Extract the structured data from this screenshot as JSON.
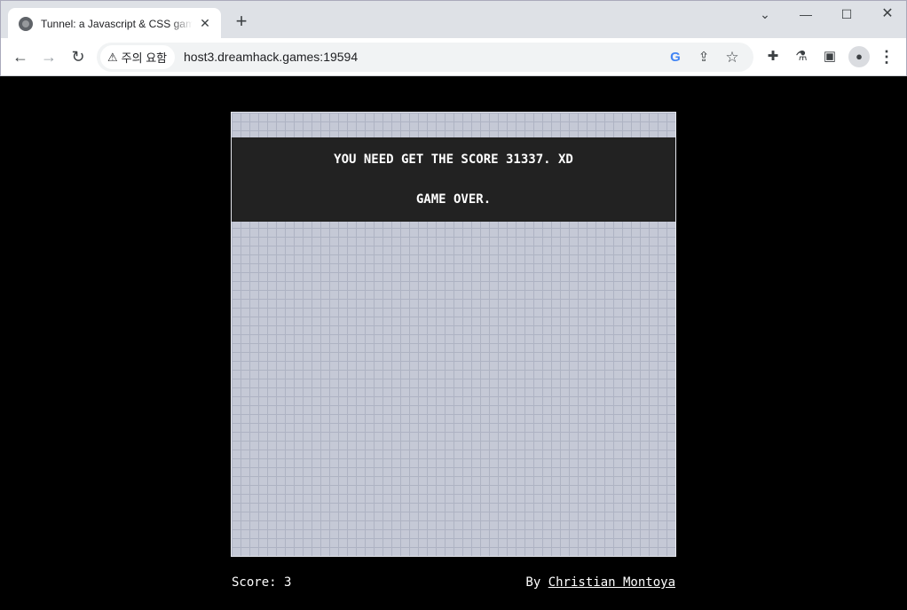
{
  "browser": {
    "tab_title": "Tunnel: a Javascript & CSS game",
    "tab_close": "✕",
    "new_tab": "+",
    "security_chip": "주의 요함",
    "url": "host3.dreamhack.games:19594"
  },
  "game": {
    "message_line1": "YOU NEED GET THE SCORE 31337. XD",
    "message_line2": "GAME OVER.",
    "score_label": "Score: 3",
    "by_prefix": "By ",
    "author_link": "Christian Montoya"
  },
  "colors": {
    "board": "#c5c9d6",
    "grid": "#aeb3c3",
    "banner": "#222222",
    "page": "#000000"
  }
}
